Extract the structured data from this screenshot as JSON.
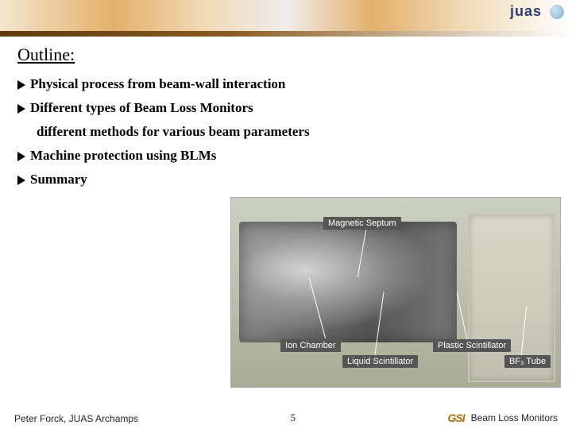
{
  "header": {
    "logo_text": "juas"
  },
  "outline": {
    "title": "Outline:",
    "items": [
      "Physical process from beam-wall interaction",
      "Different types of Beam Loss Monitors",
      "Machine protection using BLMs",
      "Summary"
    ],
    "sub_item": "different methods for various beam parameters"
  },
  "photo_labels": {
    "magnetic_septum": "Magnetic Septum",
    "ion_chamber": "Ion Chamber",
    "liquid_scint": "Liquid Scintillator",
    "plastic_scint": "Plastic Scintillator",
    "bf_tube": "BF₃ Tube"
  },
  "footer": {
    "left": "Peter Forck, JUAS Archamps",
    "page": "5",
    "right": "Beam Loss Monitors",
    "right_logo": "GSI"
  }
}
